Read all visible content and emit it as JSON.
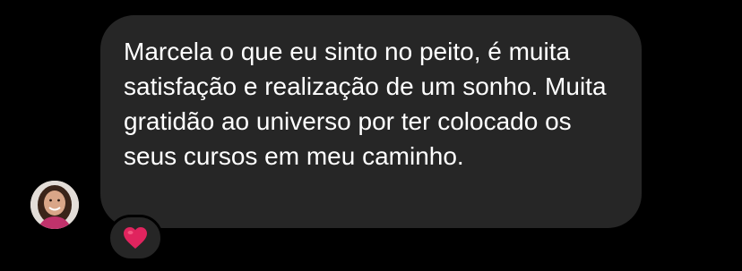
{
  "message": {
    "text": "Marcela o que eu sinto no peito, é muita satisfação e realização de um sonho. Muita gratidão ao universo por ter colocado os seus cursos em meu caminho.",
    "reaction_icon": "red-heart-icon"
  },
  "colors": {
    "background": "#000000",
    "bubble": "#262626",
    "text": "#ffffff",
    "heart": "#e0245e"
  }
}
